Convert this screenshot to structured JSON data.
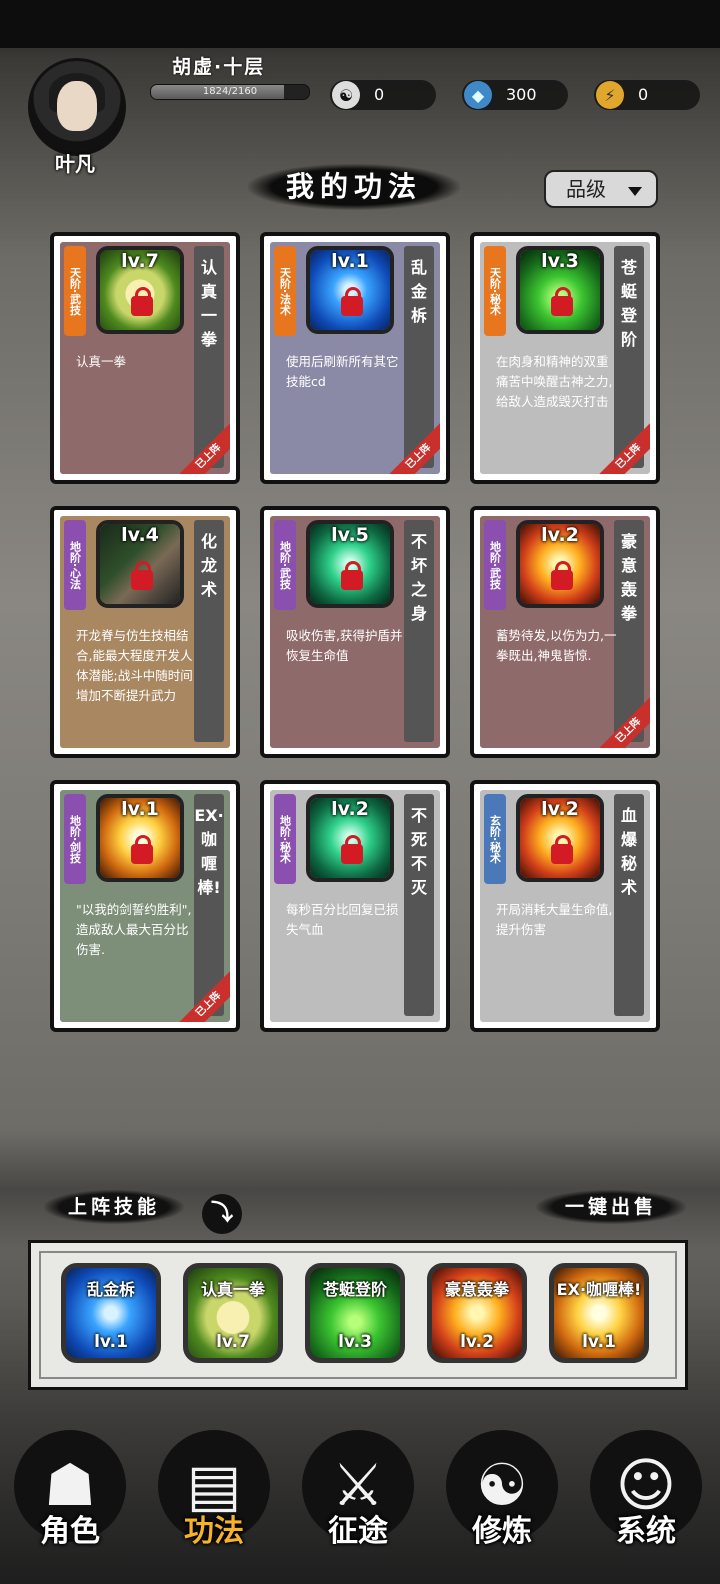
{
  "player": {
    "name": "叶凡",
    "realm": "胡虚·十层",
    "xp_text": "1824/2160",
    "xp_progress": 0.8444
  },
  "resources": [
    {
      "icon": "yin-yang-icon",
      "glyph": "☯",
      "value": "0"
    },
    {
      "icon": "spirit-stone-icon",
      "glyph": "◆",
      "value": "300"
    },
    {
      "icon": "lightning-icon",
      "glyph": "⚡",
      "value": "0"
    }
  ],
  "page": {
    "title": "我的功法",
    "sort_label": "品级"
  },
  "skills": [
    {
      "tier": "天阶·武技",
      "tier_color": "#e8761f",
      "level": "lv.7",
      "name": "认真一拳",
      "desc": "认真一拳",
      "bg": "#8f6a6a",
      "art": "fist",
      "equipped": true,
      "equipped_label": "已上阵"
    },
    {
      "tier": "天阶·法术",
      "tier_color": "#e8761f",
      "level": "lv.1",
      "name": "乱金柝",
      "desc": "使用后刷新所有其它技能cd",
      "bg": "#8b8aa6",
      "art": "blue",
      "equipped": true,
      "equipped_label": "已上阵"
    },
    {
      "tier": "天阶·秘术",
      "tier_color": "#e8761f",
      "level": "lv.3",
      "name": "苍蜓登阶",
      "desc": "在肉身和精神的双重痛苦中唤醒古神之力,给敌人造成毁灭打击",
      "bg": "#bdbdbd",
      "art": "green",
      "equipped": true,
      "equipped_label": "已上阵"
    },
    {
      "tier": "地阶·心法",
      "tier_color": "#8b4fb0",
      "level": "lv.4",
      "name": "化龙术",
      "desc": "开龙脊与仿生技相结合,能最大程度开发人体潜能;战斗中随时间增加不断提升武力",
      "bg": "#a98761",
      "art": "dark",
      "equipped": false,
      "equipped_label": ""
    },
    {
      "tier": "地阶·武技",
      "tier_color": "#8b4fb0",
      "level": "lv.5",
      "name": "不坏之身",
      "desc": "吸收伤害,获得护盾并恢复生命值",
      "bg": "#8f6a6a",
      "art": "teal",
      "equipped": false,
      "equipped_label": ""
    },
    {
      "tier": "地阶·武技",
      "tier_color": "#8b4fb0",
      "level": "lv.2",
      "name": "豪意轰拳",
      "desc": "蓄势待发,以伤为力,一拳既出,神鬼皆惊.",
      "bg": "#8f6a6a",
      "art": "fire",
      "equipped": true,
      "equipped_label": "已上阵"
    },
    {
      "tier": "地阶·剑技",
      "tier_color": "#8b4fb0",
      "level": "lv.1",
      "name": "EX·咖喱棒!",
      "desc": "\"以我的剑誓约胜利\",造成敌人最大百分比伤害.",
      "bg": "#7d8f79",
      "art": "gold",
      "equipped": true,
      "equipped_label": "已上阵"
    },
    {
      "tier": "地阶·秘术",
      "tier_color": "#8b4fb0",
      "level": "lv.2",
      "name": "不死不灭",
      "desc": "每秒百分比回复已损失气血",
      "bg": "#bdbdbd",
      "art": "teal",
      "equipped": false,
      "equipped_label": ""
    },
    {
      "tier": "玄阶·秘术",
      "tier_color": "#4a78b8",
      "level": "lv.2",
      "name": "血爆秘术",
      "desc": "开局消耗大量生命值,提升伤害",
      "bg": "#bdbdbd",
      "art": "fire",
      "equipped": false,
      "equipped_label": ""
    }
  ],
  "equip_section": {
    "label": "上阵技能",
    "sell_label": "一键出售"
  },
  "equipped_slots": [
    {
      "name": "乱金柝",
      "level": "lv.1",
      "art": "blue"
    },
    {
      "name": "认真一拳",
      "level": "lv.7",
      "art": "fist"
    },
    {
      "name": "苍蜓登阶",
      "level": "lv.3",
      "art": "green"
    },
    {
      "name": "豪意轰拳",
      "level": "lv.2",
      "art": "fire"
    },
    {
      "name": "EX·咖喱棒!",
      "level": "lv.1",
      "art": "gold"
    }
  ],
  "nav": [
    {
      "label": "角色",
      "icon": "character-icon",
      "glyph": "☗",
      "active": false
    },
    {
      "label": "功法",
      "icon": "skill-book-icon",
      "glyph": "▤",
      "active": true
    },
    {
      "label": "征途",
      "icon": "sword-icon",
      "glyph": "⚔",
      "active": false
    },
    {
      "label": "修炼",
      "icon": "meditation-icon",
      "glyph": "☯",
      "active": false
    },
    {
      "label": "系统",
      "icon": "system-icon",
      "glyph": "☺",
      "active": false
    }
  ]
}
